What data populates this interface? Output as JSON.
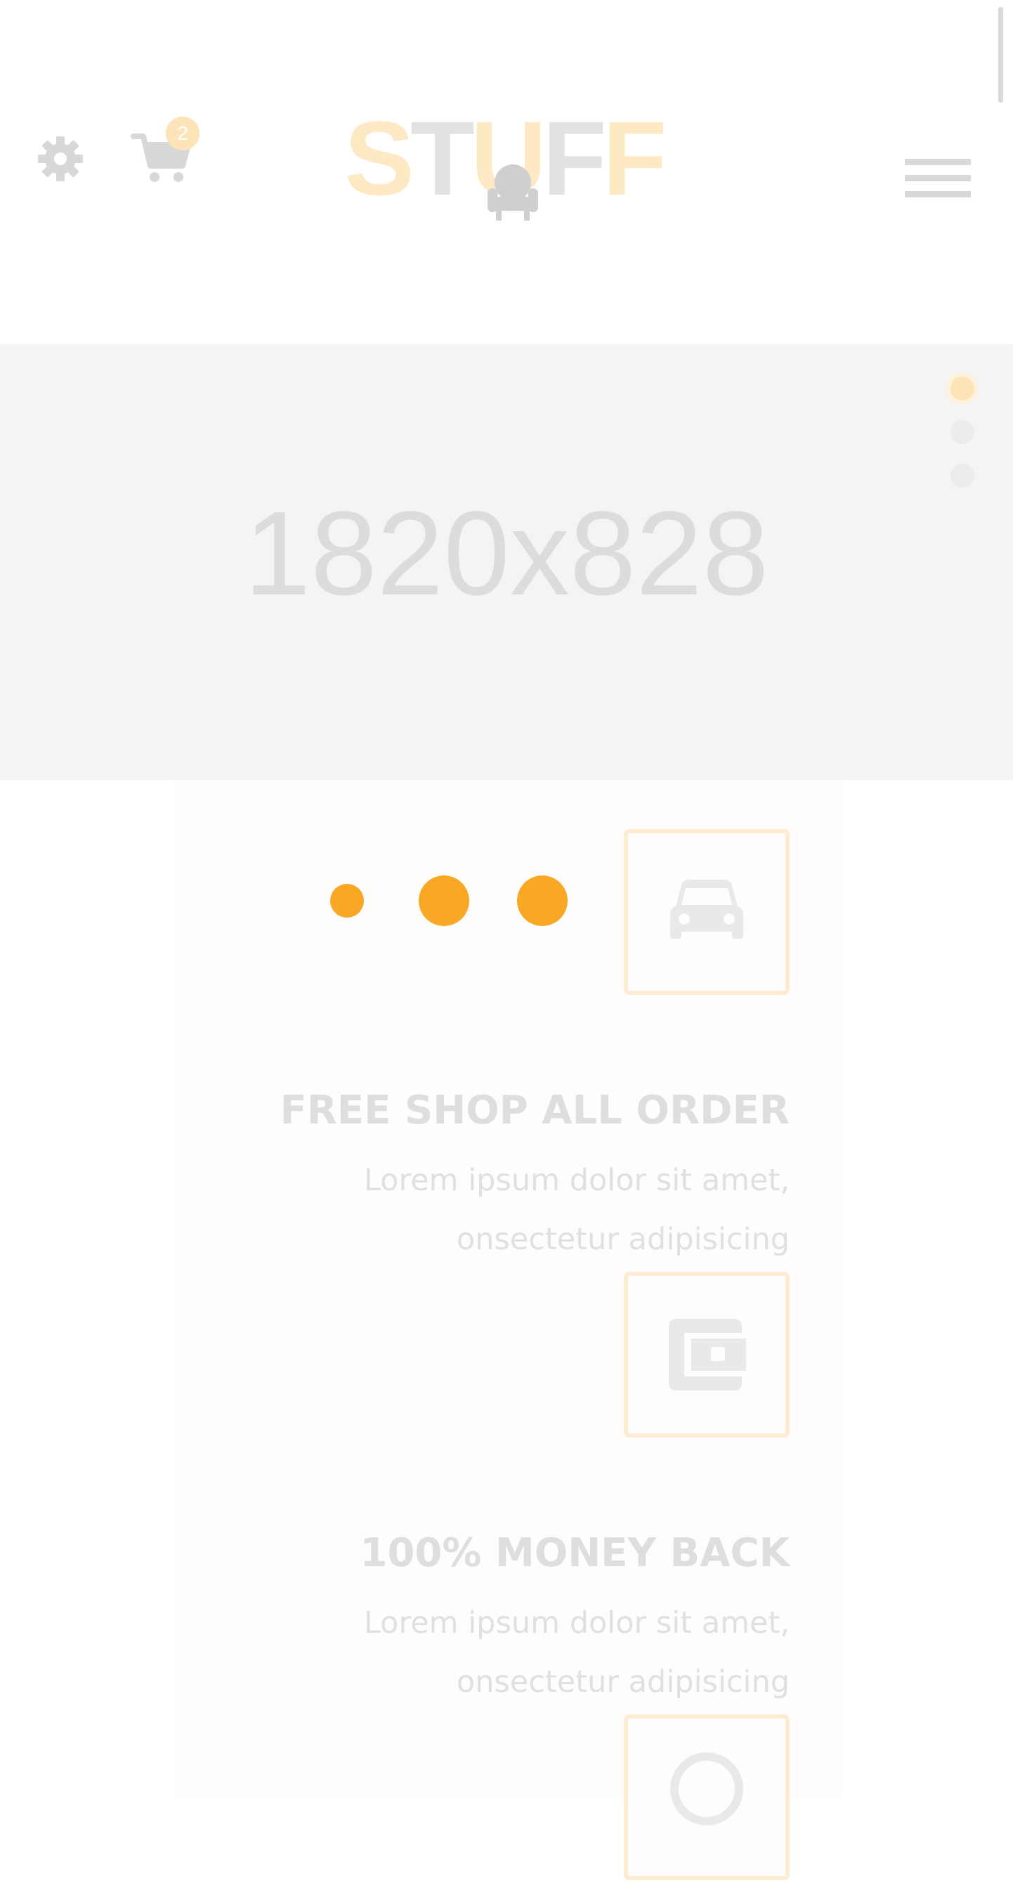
{
  "header": {
    "cart_count": "2",
    "logo_text": [
      "S",
      "T",
      "U",
      "F",
      "F"
    ],
    "icons": {
      "settings": "gear-icon",
      "cart": "cart-icon",
      "menu": "hamburger-menu-icon",
      "logo_graphic": "armchair-icon"
    }
  },
  "slider": {
    "placeholder_text": "1820x828",
    "active_slide": 1,
    "slide_count": 3
  },
  "features": [
    {
      "icon": "car-icon",
      "title": "FREE SHOP ALL ORDER",
      "description": "Lorem ipsum dolor sit amet, onsectetur adipisicing"
    },
    {
      "icon": "wallet-icon",
      "title": "100% MONEY BACK",
      "description": "Lorem ipsum dolor sit amet, onsectetur adipisicing"
    },
    {
      "icon": "support-icon",
      "title": "",
      "description": ""
    }
  ],
  "colors": {
    "accent": "#f9a826",
    "accent_light": "#fde9c4",
    "muted_gray": "#dedede",
    "slider_bg": "#f4f4f4"
  }
}
